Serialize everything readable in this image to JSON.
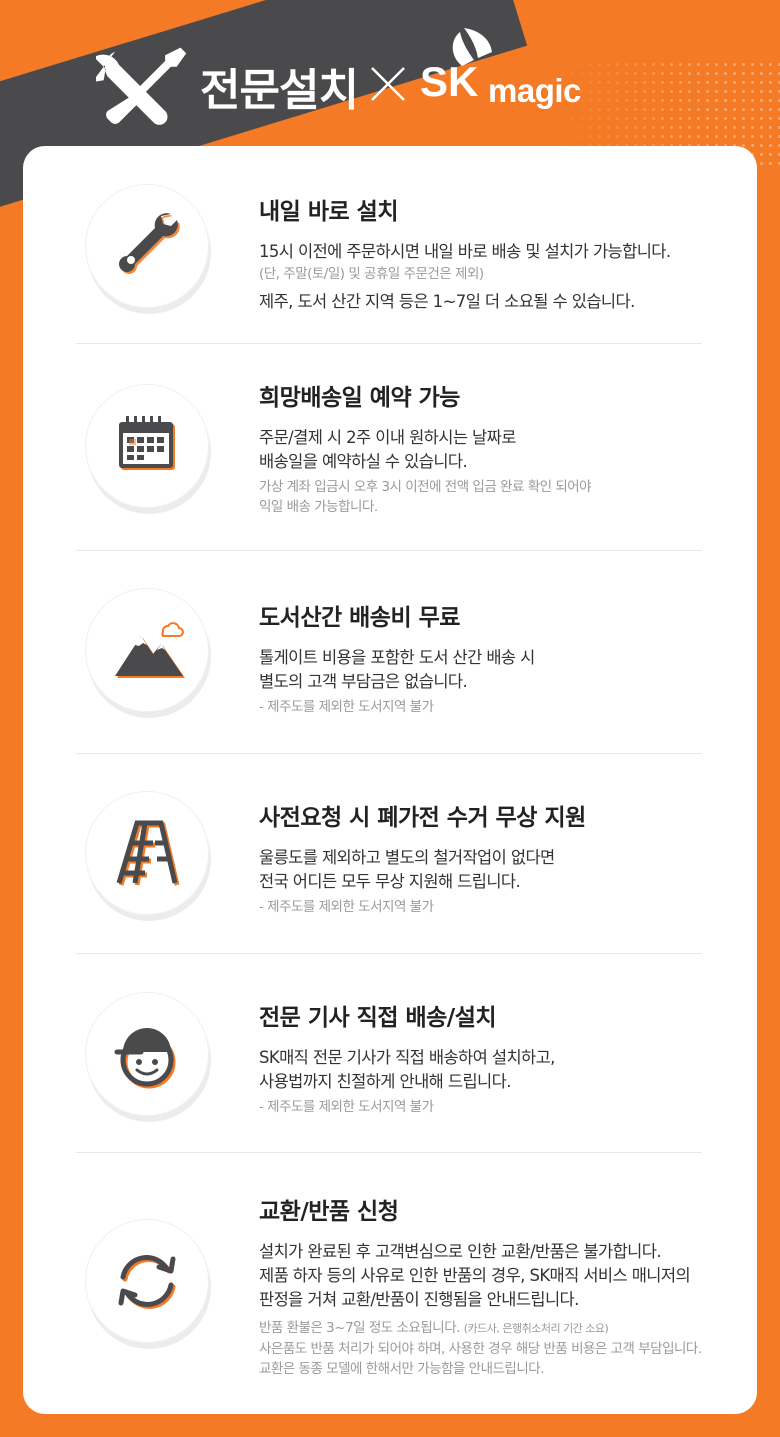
{
  "header": {
    "title": "전문설치",
    "brand_sk": "SK",
    "brand_magic": "magic"
  },
  "colors": {
    "accent": "#F47A26",
    "dark": "#4A4A4C",
    "text": "#222222",
    "muted": "#9A9A9A"
  },
  "items": [
    {
      "icon": "wrench-icon",
      "title": "내일 바로 설치",
      "desc1": "15시 이전에 주문하시면 내일 바로 배송 및 설치가 가능합니다.",
      "note1": "(단, 주말(토/일) 및 공휴일 주문건은 제외)",
      "desc2": "제주, 도서 산간 지역 등은 1~7일 더 소요될 수 있습니다."
    },
    {
      "icon": "calendar-icon",
      "title": "희망배송일 예약 가능",
      "desc1": "주문/결제 시 2주 이내 원하시는 날짜로",
      "desc2": "배송일을 예약하실 수 있습니다.",
      "note1": "가상 계좌 입금시 오후 3시 이전에 전액 입금 완료 확인 되어야",
      "note2": "익일 배송 가능합니다."
    },
    {
      "icon": "mountain-icon",
      "title": "도서산간 배송비 무료",
      "desc1": "톨게이트 비용을 포함한 도서 산간 배송 시",
      "desc2": "별도의 고객 부담금은 없습니다.",
      "note1": "- 제주도를 제외한 도서지역 불가"
    },
    {
      "icon": "ladder-icon",
      "title": "사전요청 시 폐가전 수거 무상 지원",
      "desc1": "울릉도를 제외하고 별도의 철거작업이 없다면",
      "desc2": "전국 어디든 모두 무상 지원해 드립니다.",
      "note1": "- 제주도를 제외한 도서지역 불가"
    },
    {
      "icon": "technician-icon",
      "title": "전문 기사 직접 배송/설치",
      "desc1": "SK매직 전문 기사가 직접 배송하여 설치하고,",
      "desc2": "사용법까지 친절하게 안내해 드립니다.",
      "note1": "- 제주도를 제외한 도서지역 불가"
    },
    {
      "icon": "exchange-icon",
      "title": "교환/반품 신청",
      "desc1": "설치가 완료된 후 고객변심으로 인한 교환/반품은 불가합니다.",
      "desc2": "제품 하자 등의 사유로 인한 반품의 경우, SK매직 서비스 매니저의",
      "desc3": "판정을 거쳐 교환/반품이 진행됨을 안내드립니다.",
      "note1": "반품 환불은 3~7일 정도 소요됩니다.",
      "note1_small": "(카드사, 은행취소처리 기간 소요)",
      "note2": "사은품도 반품 처리가 되어야 하며, 사용한 경우 해당 반품 비용은 고객 부담입니다.",
      "note3": "교환은 동종 모델에 한해서만 가능함을 안내드립니다."
    }
  ]
}
